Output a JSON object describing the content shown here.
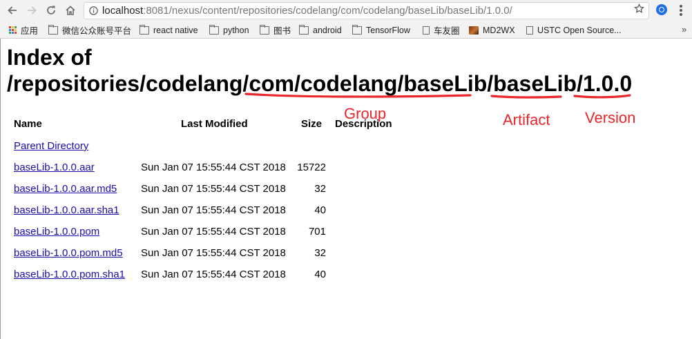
{
  "browser": {
    "url_host": "localhost",
    "url_path": ":8081/nexus/content/repositories/codelang/com/codelang/baseLib/baseLib/1.0.0/"
  },
  "bookmarks": [
    {
      "label": "应用",
      "icon": "apps-grid-icon"
    },
    {
      "label": "微信公众账号平台",
      "icon": "folder-icon"
    },
    {
      "label": "react native",
      "icon": "folder-icon"
    },
    {
      "label": "python",
      "icon": "folder-icon"
    },
    {
      "label": "图书",
      "icon": "folder-icon"
    },
    {
      "label": "android",
      "icon": "folder-icon"
    },
    {
      "label": "TensorFlow",
      "icon": "folder-icon"
    },
    {
      "label": "车友圈",
      "icon": "page-icon"
    },
    {
      "label": "MD2WX",
      "icon": "image-icon"
    },
    {
      "label": "USTC Open Source...",
      "icon": "page-icon"
    }
  ],
  "bookmarks_overflow": "»",
  "page": {
    "title_line1": "Index of",
    "title_line2": "/repositories/codelang/com/codelang/baseLib/baseLib/1.0.0",
    "columns": {
      "name": "Name",
      "last_modified": "Last Modified",
      "size": "Size",
      "description": "Description"
    },
    "parent": "Parent Directory",
    "rows": [
      {
        "name": "baseLib-1.0.0.aar",
        "modified": "Sun Jan 07 15:55:44 CST 2018",
        "size": "15722"
      },
      {
        "name": "baseLib-1.0.0.aar.md5",
        "modified": "Sun Jan 07 15:55:44 CST 2018",
        "size": "32"
      },
      {
        "name": "baseLib-1.0.0.aar.sha1",
        "modified": "Sun Jan 07 15:55:44 CST 2018",
        "size": "40"
      },
      {
        "name": "baseLib-1.0.0.pom",
        "modified": "Sun Jan 07 15:55:44 CST 2018",
        "size": "701"
      },
      {
        "name": "baseLib-1.0.0.pom.md5",
        "modified": "Sun Jan 07 15:55:44 CST 2018",
        "size": "32"
      },
      {
        "name": "baseLib-1.0.0.pom.sha1",
        "modified": "Sun Jan 07 15:55:44 CST 2018",
        "size": "40"
      }
    ]
  },
  "annotations": {
    "group": "Group",
    "artifact": "Artifact",
    "version": "Version",
    "color": "#e8262b"
  }
}
